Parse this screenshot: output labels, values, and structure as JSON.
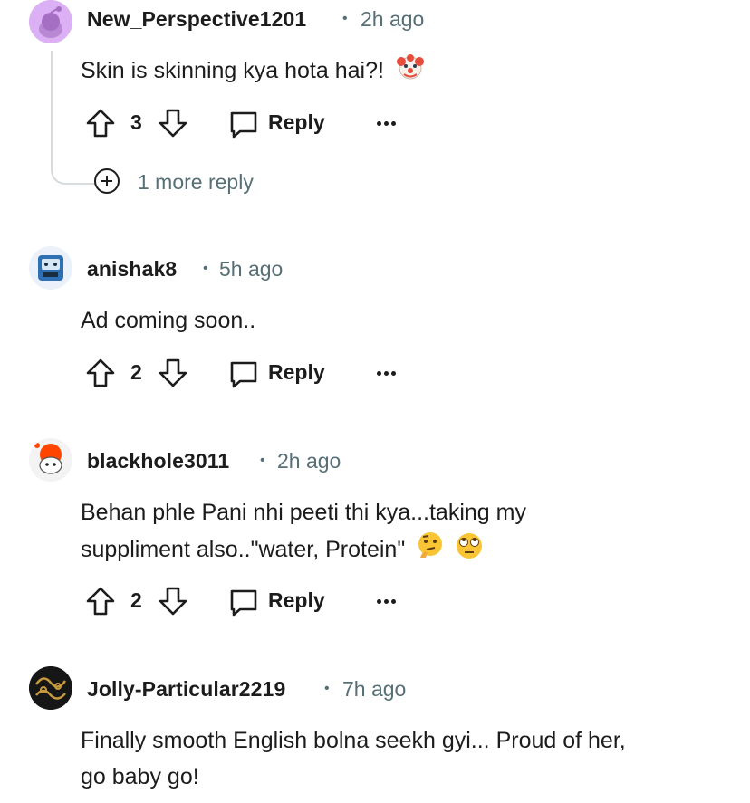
{
  "comments": [
    {
      "username": "New_Perspective1201",
      "time": "2h ago",
      "body": "Skin is skinning kya hota hai?!",
      "emoji": [
        "clown-face"
      ],
      "score": "3",
      "reply_label": "Reply",
      "more_replies": "1 more reply"
    },
    {
      "username": "anishak8",
      "time": "5h ago",
      "body": "Ad coming soon..",
      "score": "2",
      "reply_label": "Reply"
    },
    {
      "username": "blackhole3011",
      "time": "2h ago",
      "body_line1": "Behan phle Pani nhi peeti thi kya...taking my",
      "body_line2": "suppliment also..\"water, Protein\"",
      "emoji": [
        "thinking-face",
        "eye-roll-face"
      ],
      "score": "2",
      "reply_label": "Reply"
    },
    {
      "username": "Jolly-Particular2219",
      "time": "7h ago",
      "body_line1": "Finally smooth English bolna seekh gyi... Proud of her,",
      "body_line2": "go baby go!"
    }
  ],
  "colors": {
    "text": "#1c1c1c",
    "muted": "#576f76",
    "thread": "#d6dbdd"
  }
}
